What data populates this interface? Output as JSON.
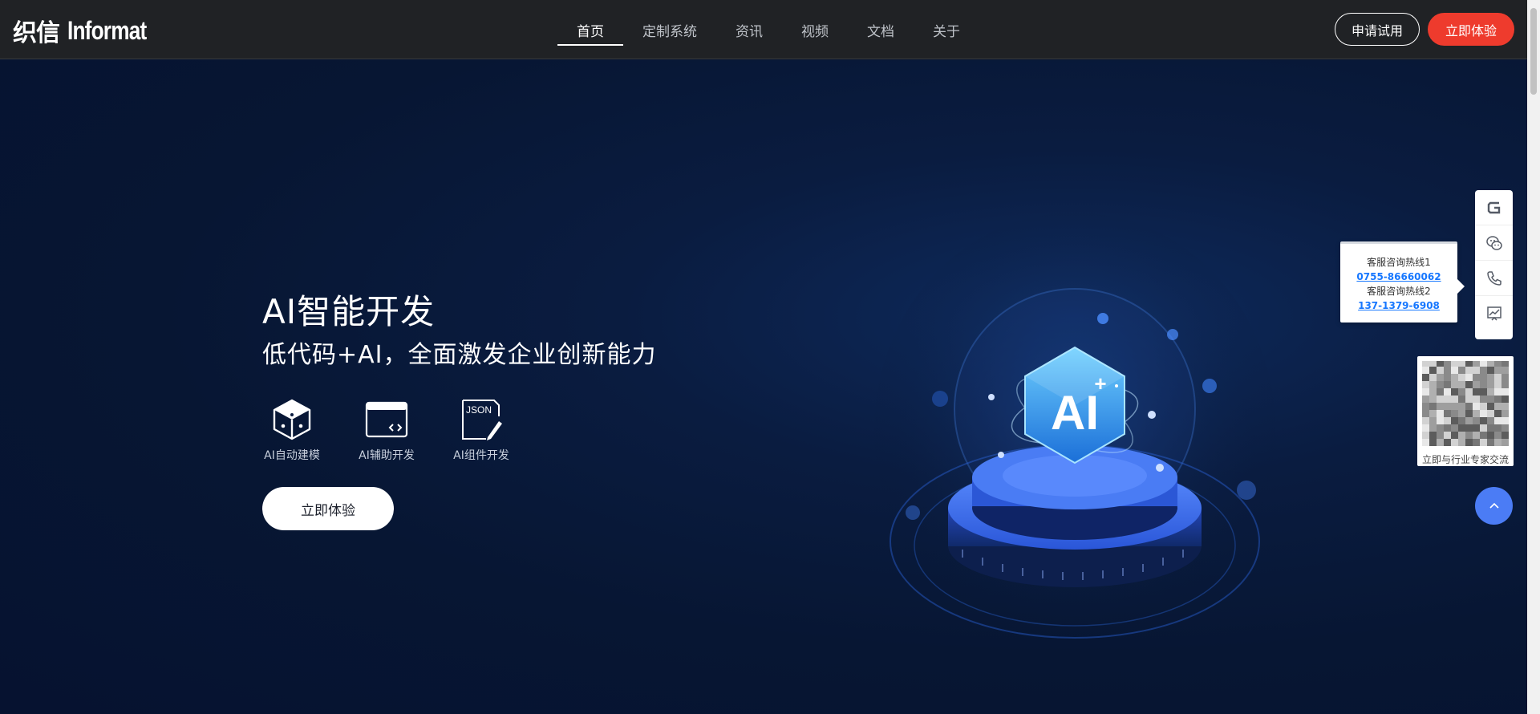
{
  "header": {
    "logo_cn": "织信",
    "logo_en": "Informat",
    "nav": [
      {
        "label": "首页",
        "active": true
      },
      {
        "label": "定制系统",
        "active": false
      },
      {
        "label": "资讯",
        "active": false
      },
      {
        "label": "视频",
        "active": false
      },
      {
        "label": "文档",
        "active": false
      },
      {
        "label": "关于",
        "active": false
      }
    ],
    "apply_trial_label": "申请试用",
    "experience_label": "立即体验"
  },
  "hero": {
    "title": "AI智能开发",
    "subtitle": "低代码+AI，全面激发企业创新能力",
    "features": [
      {
        "icon": "cube-icon",
        "label": "AI自动建模"
      },
      {
        "icon": "code-window-icon",
        "label": "AI辅助开发"
      },
      {
        "icon": "json-edit-icon",
        "label": "AI组件开发"
      }
    ],
    "json_badge": "JSON",
    "cta_label": "立即体验",
    "illustration_text": "AI"
  },
  "side_widgets": {
    "hotline_1_label": "客服咨询热线1",
    "hotline_1_number": "0755-86660062",
    "hotline_2_label": "客服咨询热线2",
    "hotline_2_number": "137-1379-6908",
    "qr_caption": "立即与行业专家交流",
    "icons": [
      "g-logo-icon",
      "wechat-icon",
      "phone-icon",
      "chart-icon"
    ]
  },
  "colors": {
    "navbar_bg": "#202225",
    "hero_bg": "#071633",
    "accent_red": "#ee3b2d",
    "accent_blue": "#4b7cf5",
    "link_blue": "#1677ff"
  }
}
